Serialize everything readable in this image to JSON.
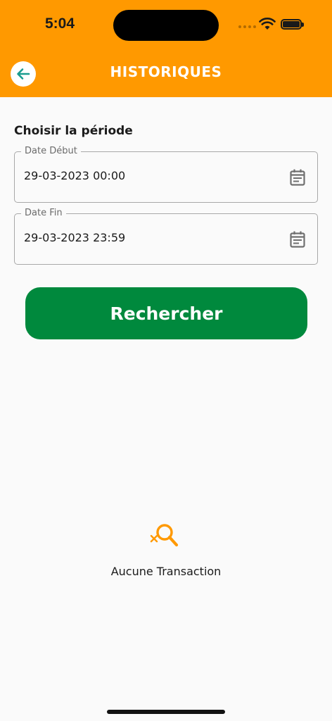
{
  "status_bar": {
    "time": "5:04"
  },
  "header": {
    "title": "HISTORIQUES",
    "background": "#ff9900",
    "back_icon": "arrow-left-icon"
  },
  "period": {
    "title": "Choisir la période",
    "start": {
      "label": "Date Début",
      "value": "29-03-2023 00:00",
      "icon": "calendar-icon"
    },
    "end": {
      "label": "Date Fin",
      "value": "29-03-2023 23:59",
      "icon": "calendar-icon"
    }
  },
  "search_button": {
    "label": "Rechercher",
    "color": "#00893d"
  },
  "empty_state": {
    "icon": "search-off-icon",
    "text": "Aucune Transaction",
    "icon_color": "#ff9900"
  }
}
